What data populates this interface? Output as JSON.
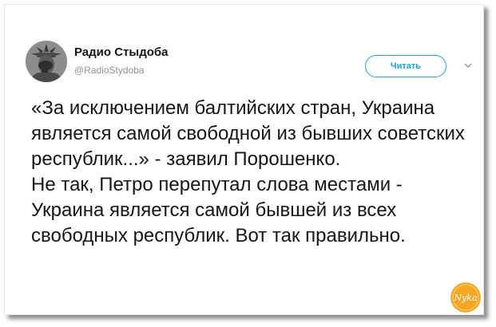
{
  "tweet": {
    "display_name": "Радио Стыдоба",
    "handle": "@RadioStydoba",
    "follow_label": "Читать",
    "paragraph_1": "«За исключением балтийских стран, Украина является самой свободной из бывших советских республик...» - заявил Порошенко.",
    "paragraph_2": "Не так, Петро перепутал слова местами - Украина является самой бывшей из всех свободных республик. Вот так правильно."
  },
  "icons": {
    "avatar": "statue-of-liberty-face-palm-avatar",
    "menu": "chevron-down-icon",
    "watermark": "nyka-logo"
  },
  "watermark_text": "Nyka",
  "colors": {
    "accent": "#1da1f2",
    "text": "#14171a",
    "muted": "#8a949c",
    "watermark": "#f5a623"
  }
}
